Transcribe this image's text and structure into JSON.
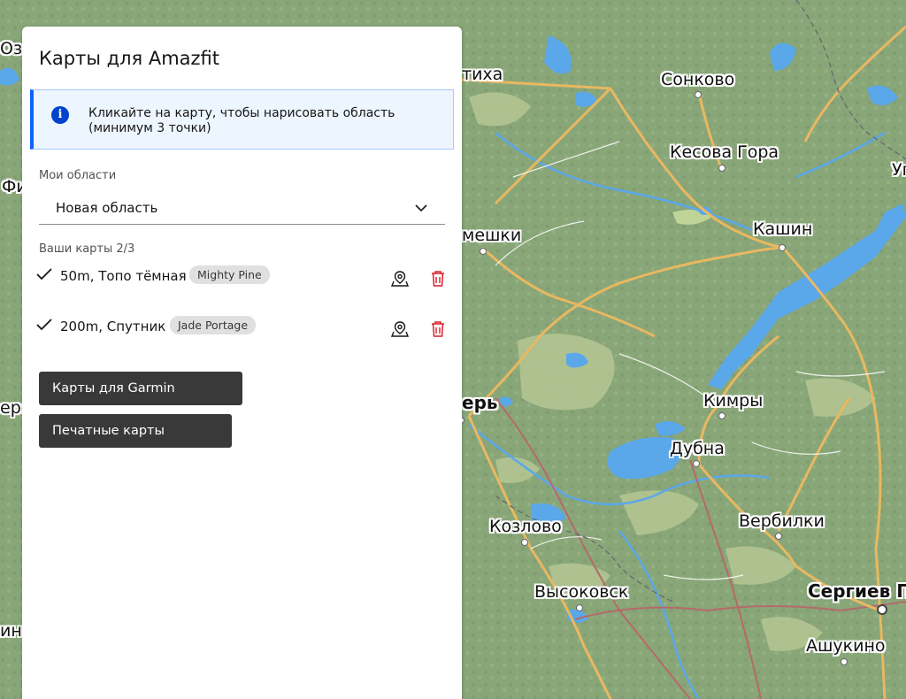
{
  "map": {
    "labels": [
      {
        "id": "ozer",
        "text": "Озё"
      },
      {
        "id": "tikha",
        "text": "тиха"
      },
      {
        "id": "sonkovo",
        "text": "Сонково"
      },
      {
        "id": "kesova",
        "text": "Кесова Гора"
      },
      {
        "id": "fi",
        "text": "Фи"
      },
      {
        "id": "ug",
        "text": "Уг"
      },
      {
        "id": "kashin",
        "text": "Кашин"
      },
      {
        "id": "meshki",
        "text": "мешки"
      },
      {
        "id": "ero",
        "text": "еро"
      },
      {
        "id": "ter",
        "text": "ерь"
      },
      {
        "id": "kimry",
        "text": "Кимры"
      },
      {
        "id": "dubna",
        "text": "Дубна"
      },
      {
        "id": "kozlovo",
        "text": "Козлово"
      },
      {
        "id": "verbilki",
        "text": "Вербилки"
      },
      {
        "id": "vysokovsk",
        "text": "Высоковск"
      },
      {
        "id": "sergiev",
        "text": "Сергиев П"
      },
      {
        "id": "in",
        "text": "ин"
      },
      {
        "id": "ashukino",
        "text": "Ашукино"
      }
    ]
  },
  "panel": {
    "title": "Карты для Amazfit",
    "info_text": "Кликайте на карту, чтобы нарисовать область (минимум 3 точки)",
    "areas_label": "Мои области",
    "selected_area": "Новая область",
    "maps_label": "Ваши карты 2/3",
    "maps": [
      {
        "name": "50m, Топо тёмная",
        "tag": "Mighty Pine"
      },
      {
        "name": "200m, Спутник",
        "tag": "Jade Portage"
      }
    ],
    "garmin_button": "Карты для Garmin",
    "print_button": "Печатные карты"
  },
  "colors": {
    "forest": "#8aa77a",
    "field": "#b9c99a",
    "water": "#5aa3e6",
    "road": "#e8b860",
    "panel_button": "#393939",
    "info_accent": "#0f62fe",
    "delete_icon": "#da1e28"
  }
}
